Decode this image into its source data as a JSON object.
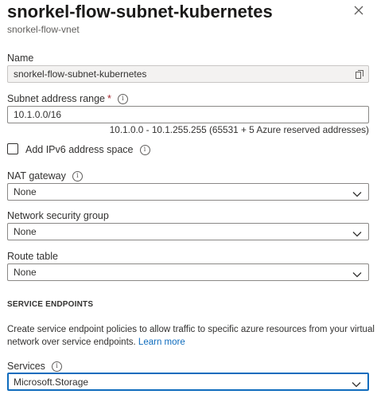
{
  "header": {
    "title": "snorkel-flow-subnet-kubernetes",
    "subtitle": "snorkel-flow-vnet"
  },
  "name_field": {
    "label": "Name",
    "value": "snorkel-flow-subnet-kubernetes"
  },
  "address_range": {
    "label": "Subnet address range",
    "required_mark": "*",
    "value": "10.1.0.0/16",
    "hint": "10.1.0.0 - 10.1.255.255 (65531 + 5 Azure reserved addresses)"
  },
  "ipv6": {
    "label": "Add IPv6 address space",
    "checked": false
  },
  "nat_gateway": {
    "label": "NAT gateway",
    "value": "None"
  },
  "nsg": {
    "label": "Network security group",
    "value": "None"
  },
  "route_table": {
    "label": "Route table",
    "value": "None"
  },
  "service_endpoints": {
    "heading": "SERVICE ENDPOINTS",
    "description": "Create service endpoint policies to allow traffic to specific azure resources from your virtual network over service endpoints.",
    "learn_more": "Learn more",
    "services_label": "Services",
    "services_value": "Microsoft.Storage"
  },
  "colors": {
    "accent": "#0f6cbd",
    "required": "#a4262c",
    "readonly_bg": "#f3f2f1"
  }
}
